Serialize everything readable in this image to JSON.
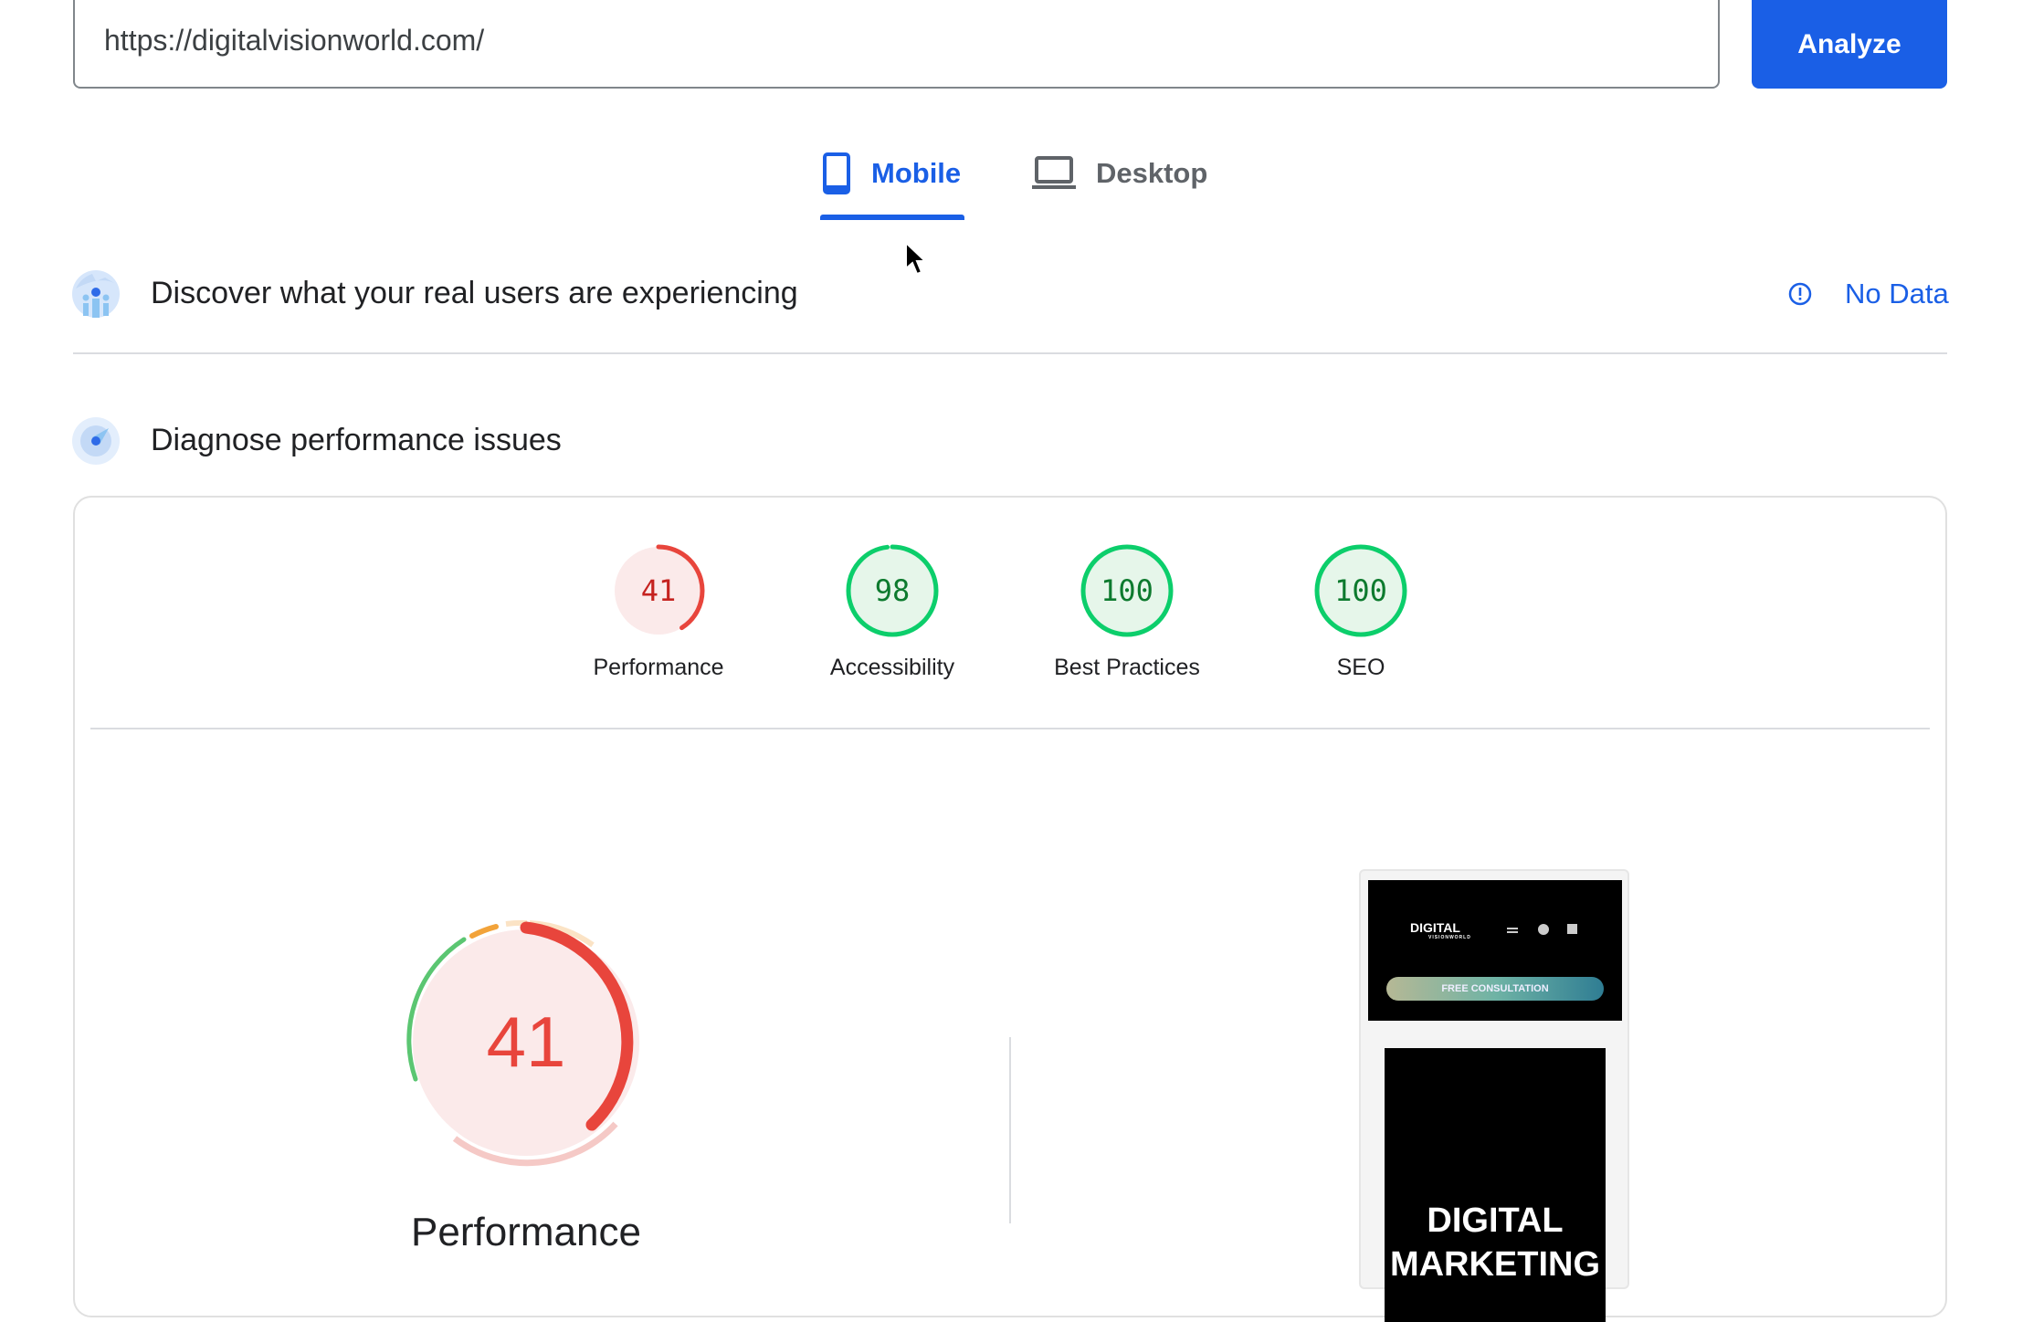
{
  "search": {
    "url": "https://digitalvisionworld.com/",
    "analyze_label": "Analyze"
  },
  "tabs": [
    {
      "label": "Mobile",
      "icon": "smartphone-icon",
      "active": true
    },
    {
      "label": "Desktop",
      "icon": "laptop-icon",
      "active": false
    }
  ],
  "field_data": {
    "title": "Discover what your real users are experiencing",
    "status": "No Data",
    "icon": "info-icon"
  },
  "lab_data": {
    "title": "Diagnose performance issues"
  },
  "scores": [
    {
      "label": "Performance",
      "value": 41,
      "status": "fail"
    },
    {
      "label": "Accessibility",
      "value": 98,
      "status": "pass"
    },
    {
      "label": "Best Practices",
      "value": 100,
      "status": "pass"
    },
    {
      "label": "SEO",
      "value": 100,
      "status": "pass"
    }
  ],
  "main_gauge": {
    "label": "Performance",
    "value": 41
  },
  "screenshot": {
    "brand": "DIGITAL",
    "brand_sub": "VISIONWORLD",
    "cta": "FREE CONSULTATION",
    "hero": "DIGITAL MARKETING"
  },
  "colors": {
    "accent": "#1a5fe6",
    "fail": "#e8453c",
    "fail_bg": "#fbeaea",
    "pass": "#0cce6b",
    "pass_text": "#0d7a2e",
    "pass_bg": "#e6f6ea",
    "average": "#f2a33a"
  }
}
